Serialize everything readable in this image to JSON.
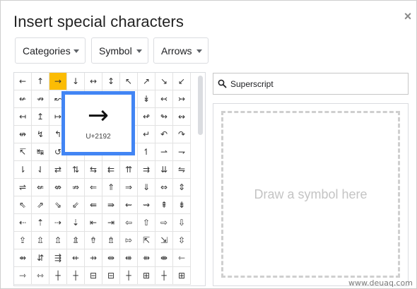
{
  "dialog": {
    "title": "Insert special characters",
    "close_glyph": "×"
  },
  "filters": [
    {
      "label": "Categories"
    },
    {
      "label": "Symbol"
    },
    {
      "label": "Arrows"
    }
  ],
  "grid": {
    "selected_index": 2,
    "rows": [
      [
        "←",
        "↑",
        "→",
        "↓",
        "↔",
        "↕",
        "↖",
        "↗",
        "↘",
        "↙"
      ],
      [
        "↚",
        "↛",
        "↜",
        "↝",
        "↞",
        "↟",
        "↠",
        "↡",
        "↢",
        "↣"
      ],
      [
        "↤",
        "↥",
        "↦",
        "↧",
        "↨",
        "↩",
        "↪",
        "↫",
        "↬",
        "↭"
      ],
      [
        "↮",
        "↯",
        "↰",
        "↱",
        "↲",
        "↳",
        "↴",
        "↵",
        "↶",
        "↷"
      ],
      [
        "↸",
        "↹",
        "↺",
        "↻",
        "↼",
        "↽",
        "↾",
        "↿",
        "⇀",
        "⇁"
      ],
      [
        "⇂",
        "⇃",
        "⇄",
        "⇅",
        "⇆",
        "⇇",
        "⇈",
        "⇉",
        "⇊",
        "⇋"
      ],
      [
        "⇌",
        "⇍",
        "⇎",
        "⇏",
        "⇐",
        "⇑",
        "⇒",
        "⇓",
        "⇔",
        "⇕"
      ],
      [
        "⇖",
        "⇗",
        "⇘",
        "⇙",
        "⇚",
        "⇛",
        "⇜",
        "⇝",
        "⇞",
        "⇟"
      ],
      [
        "⇠",
        "⇡",
        "⇢",
        "⇣",
        "⇤",
        "⇥",
        "⇦",
        "⇧",
        "⇨",
        "⇩"
      ],
      [
        "⇪",
        "⇫",
        "⇬",
        "⇭",
        "⇮",
        "⇯",
        "⇰",
        "⇱",
        "⇲",
        "⇳"
      ],
      [
        "⇴",
        "⇵",
        "⇶",
        "⇷",
        "⇸",
        "⇹",
        "⇺",
        "⇻",
        "⇼",
        "⇽"
      ],
      [
        "⇾",
        "⇿",
        "┼",
        "┼",
        "⊟",
        "⊟",
        "┼",
        "⊞",
        "┼",
        "⊞"
      ]
    ]
  },
  "preview": {
    "glyph": "→",
    "codepoint": "U+2192"
  },
  "search": {
    "value": "Superscript",
    "icon": "search-icon"
  },
  "draw": {
    "placeholder": "Draw a symbol here"
  },
  "watermark": "www.deuaq.com"
}
